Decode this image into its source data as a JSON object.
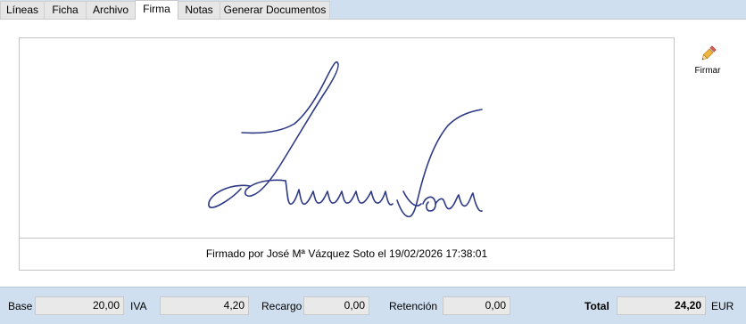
{
  "tabs": [
    {
      "label": "Líneas"
    },
    {
      "label": "Ficha"
    },
    {
      "label": "Archivo"
    },
    {
      "label": "Firma",
      "active": true
    },
    {
      "label": "Notas"
    },
    {
      "label": "Generar Documentos"
    }
  ],
  "signature": {
    "caption": "Firmado por José Mª Vázquez Soto el 19/02/2026 17:38:01",
    "ink_color": "#2e3a86"
  },
  "toolbar": {
    "sign_label": "Firmar",
    "sign_icon": "pencil-icon"
  },
  "totals": {
    "base_label": "Base",
    "base_value": "20,00",
    "iva_label": "IVA",
    "iva_value": "4,20",
    "recargo_label": "Recargo",
    "recargo_value": "0,00",
    "retencion_label": "Retención",
    "retencion_value": "0,00",
    "total_label": "Total",
    "total_value": "24,20",
    "currency": "EUR"
  }
}
